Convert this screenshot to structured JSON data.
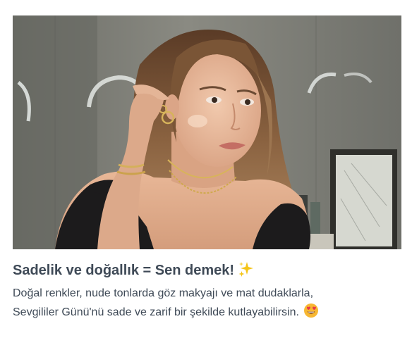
{
  "card": {
    "title": "Sadelik ve doğallık = Sen demek!",
    "title_emoji": "sparkles-icon",
    "description_line1": "Doğal renkler, nude tonlarda göz makyajı ve mat dudaklarla,",
    "description_line2": "Sevgililer Günü'nü sade ve zarif bir şekilde kutlayabilirsin.",
    "description_emoji": "heart-eyes-emoji-icon"
  },
  "colors": {
    "text": "#3f4a57",
    "background": "#ffffff",
    "sparkle": "#f5c518",
    "emoji_face": "#f7b733",
    "emoji_heart": "#e8364b"
  }
}
